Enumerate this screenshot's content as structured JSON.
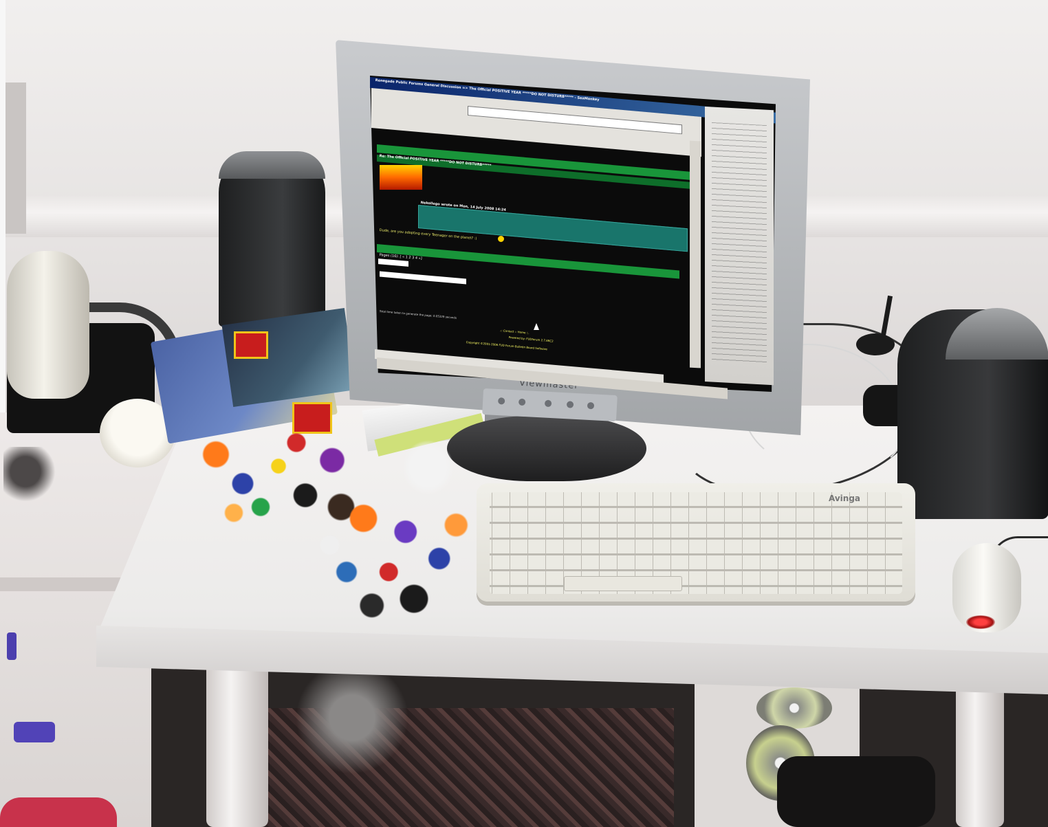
{
  "scene": {
    "type": "desk-photo",
    "objects": [
      "lcd-monitor",
      "keyboard",
      "mouse",
      "speakers",
      "desk-lamp",
      "lego-minifigures",
      "lego-manuals",
      "cds",
      "cables"
    ]
  },
  "monitor": {
    "brand": "Viewmaster"
  },
  "browser": {
    "window_title": "Renegade Public Forums General Discussion => The Official POSITIVE YEAR *****DO NOT DISTURB***** - SeaMonkey",
    "post_title": "Re: The Official POSITIVE YEAR *****DO NOT DISTURB*****",
    "quote_header": "Nekollego wrote on Mon, 14 July 2008 14:24",
    "post_text": "Dude, are you adopting every Teenager on the planet? :)",
    "pages_text": "Pages (16): [ « 1 2 3 4 »]",
    "generation_text": "Total time taken to generate the page: 0.05329 seconds",
    "footer_line_1": ".:: Contact :: Home ::.",
    "footer_line_2": "Powered by: FUDforum 2.7.6RC2",
    "footer_line_3": "Copyright ©2001-2006 FUD Forum Bulletin Board Software"
  },
  "keyboard": {
    "brand": "Avinga"
  },
  "colors": {
    "screen_bg": "#0b0b0b",
    "forum_green": "#19953a",
    "quote_teal": "#19756b",
    "monitor_silver": "#b4b7ba",
    "desk_white": "#efedec",
    "mouse_led": "#ff3030"
  }
}
